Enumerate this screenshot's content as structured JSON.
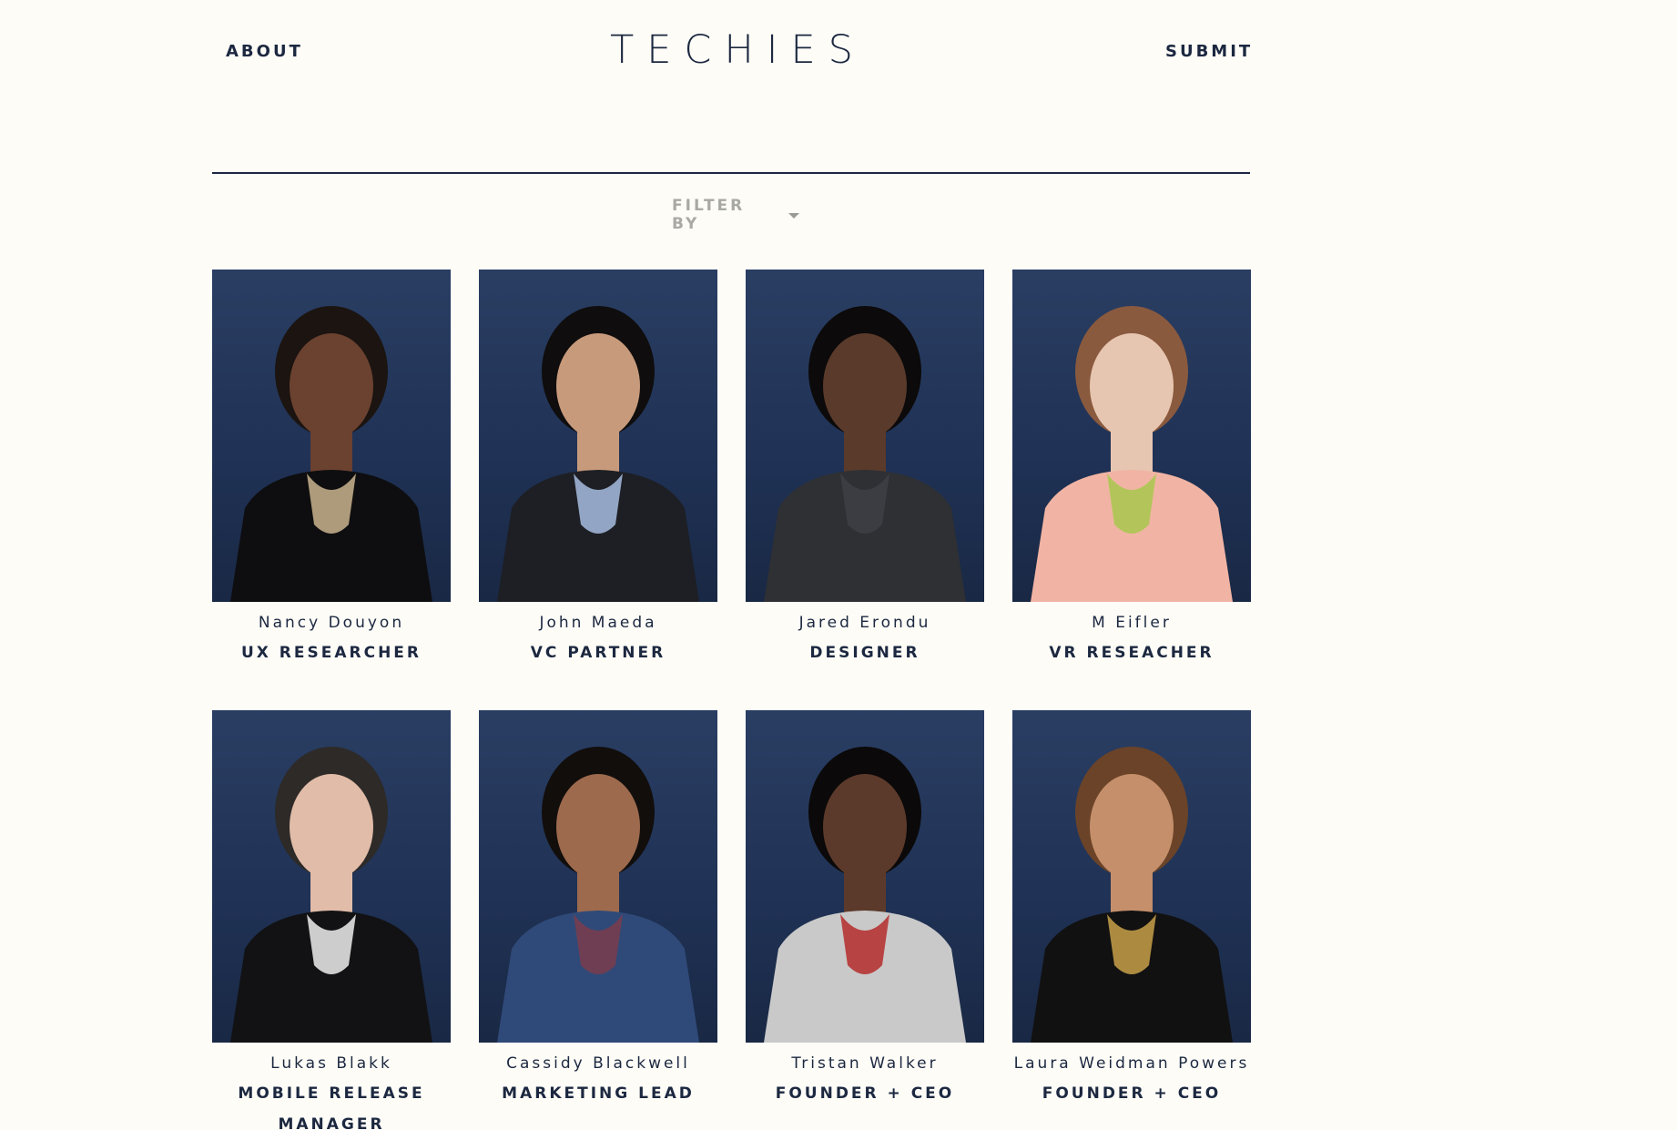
{
  "nav": {
    "about_label": "ABOUT",
    "submit_label": "SUBMIT",
    "logo_text": "TECHIES"
  },
  "filter": {
    "label": "FILTER BY"
  },
  "people": [
    {
      "name": "Nancy Douyon",
      "role": "UX RESEARCHER",
      "hair": "#1b1410",
      "skin": "#6b4130",
      "clothes": "#0e0e10",
      "accent": "#c9b48e"
    },
    {
      "name": "John Maeda",
      "role": "VC PARTNER",
      "hair": "#0f0d0d",
      "skin": "#c79a7c",
      "clothes": "#1d1f24",
      "accent": "#a7bde0"
    },
    {
      "name": "Jared Erondu",
      "role": "DESIGNER",
      "hair": "#0c0a0a",
      "skin": "#5a3a2b",
      "clothes": "#2e3034",
      "accent": "#3e4046"
    },
    {
      "name": "M Eifler",
      "role": "VR RESEACHER",
      "hair": "#8a5a3e",
      "skin": "#e7c6b1",
      "clothes": "#f1b4a4",
      "accent": "#a8c84e"
    },
    {
      "name": "Lukas Blakk",
      "role": "MOBILE RELEASE MANAGER",
      "hair": "#2d2a28",
      "skin": "#e1bca8",
      "clothes": "#121214",
      "accent": "#efefef"
    },
    {
      "name": "Cassidy Blackwell",
      "role": "MARKETING LEAD",
      "hair": "#120e0c",
      "skin": "#9d6a4e",
      "clothes": "#2f4a78",
      "accent": "#7a3c4c"
    },
    {
      "name": "Tristan Walker",
      "role": "FOUNDER + CEO",
      "hair": "#0b0909",
      "skin": "#5c3a2b",
      "clothes": "#c9c9c9",
      "accent": "#b52b2b"
    },
    {
      "name": "Laura Weidman Powers",
      "role": "FOUNDER + CEO",
      "hair": "#6b4328",
      "skin": "#c58f6b",
      "clothes": "#111111",
      "accent": "#c8a14a"
    }
  ]
}
